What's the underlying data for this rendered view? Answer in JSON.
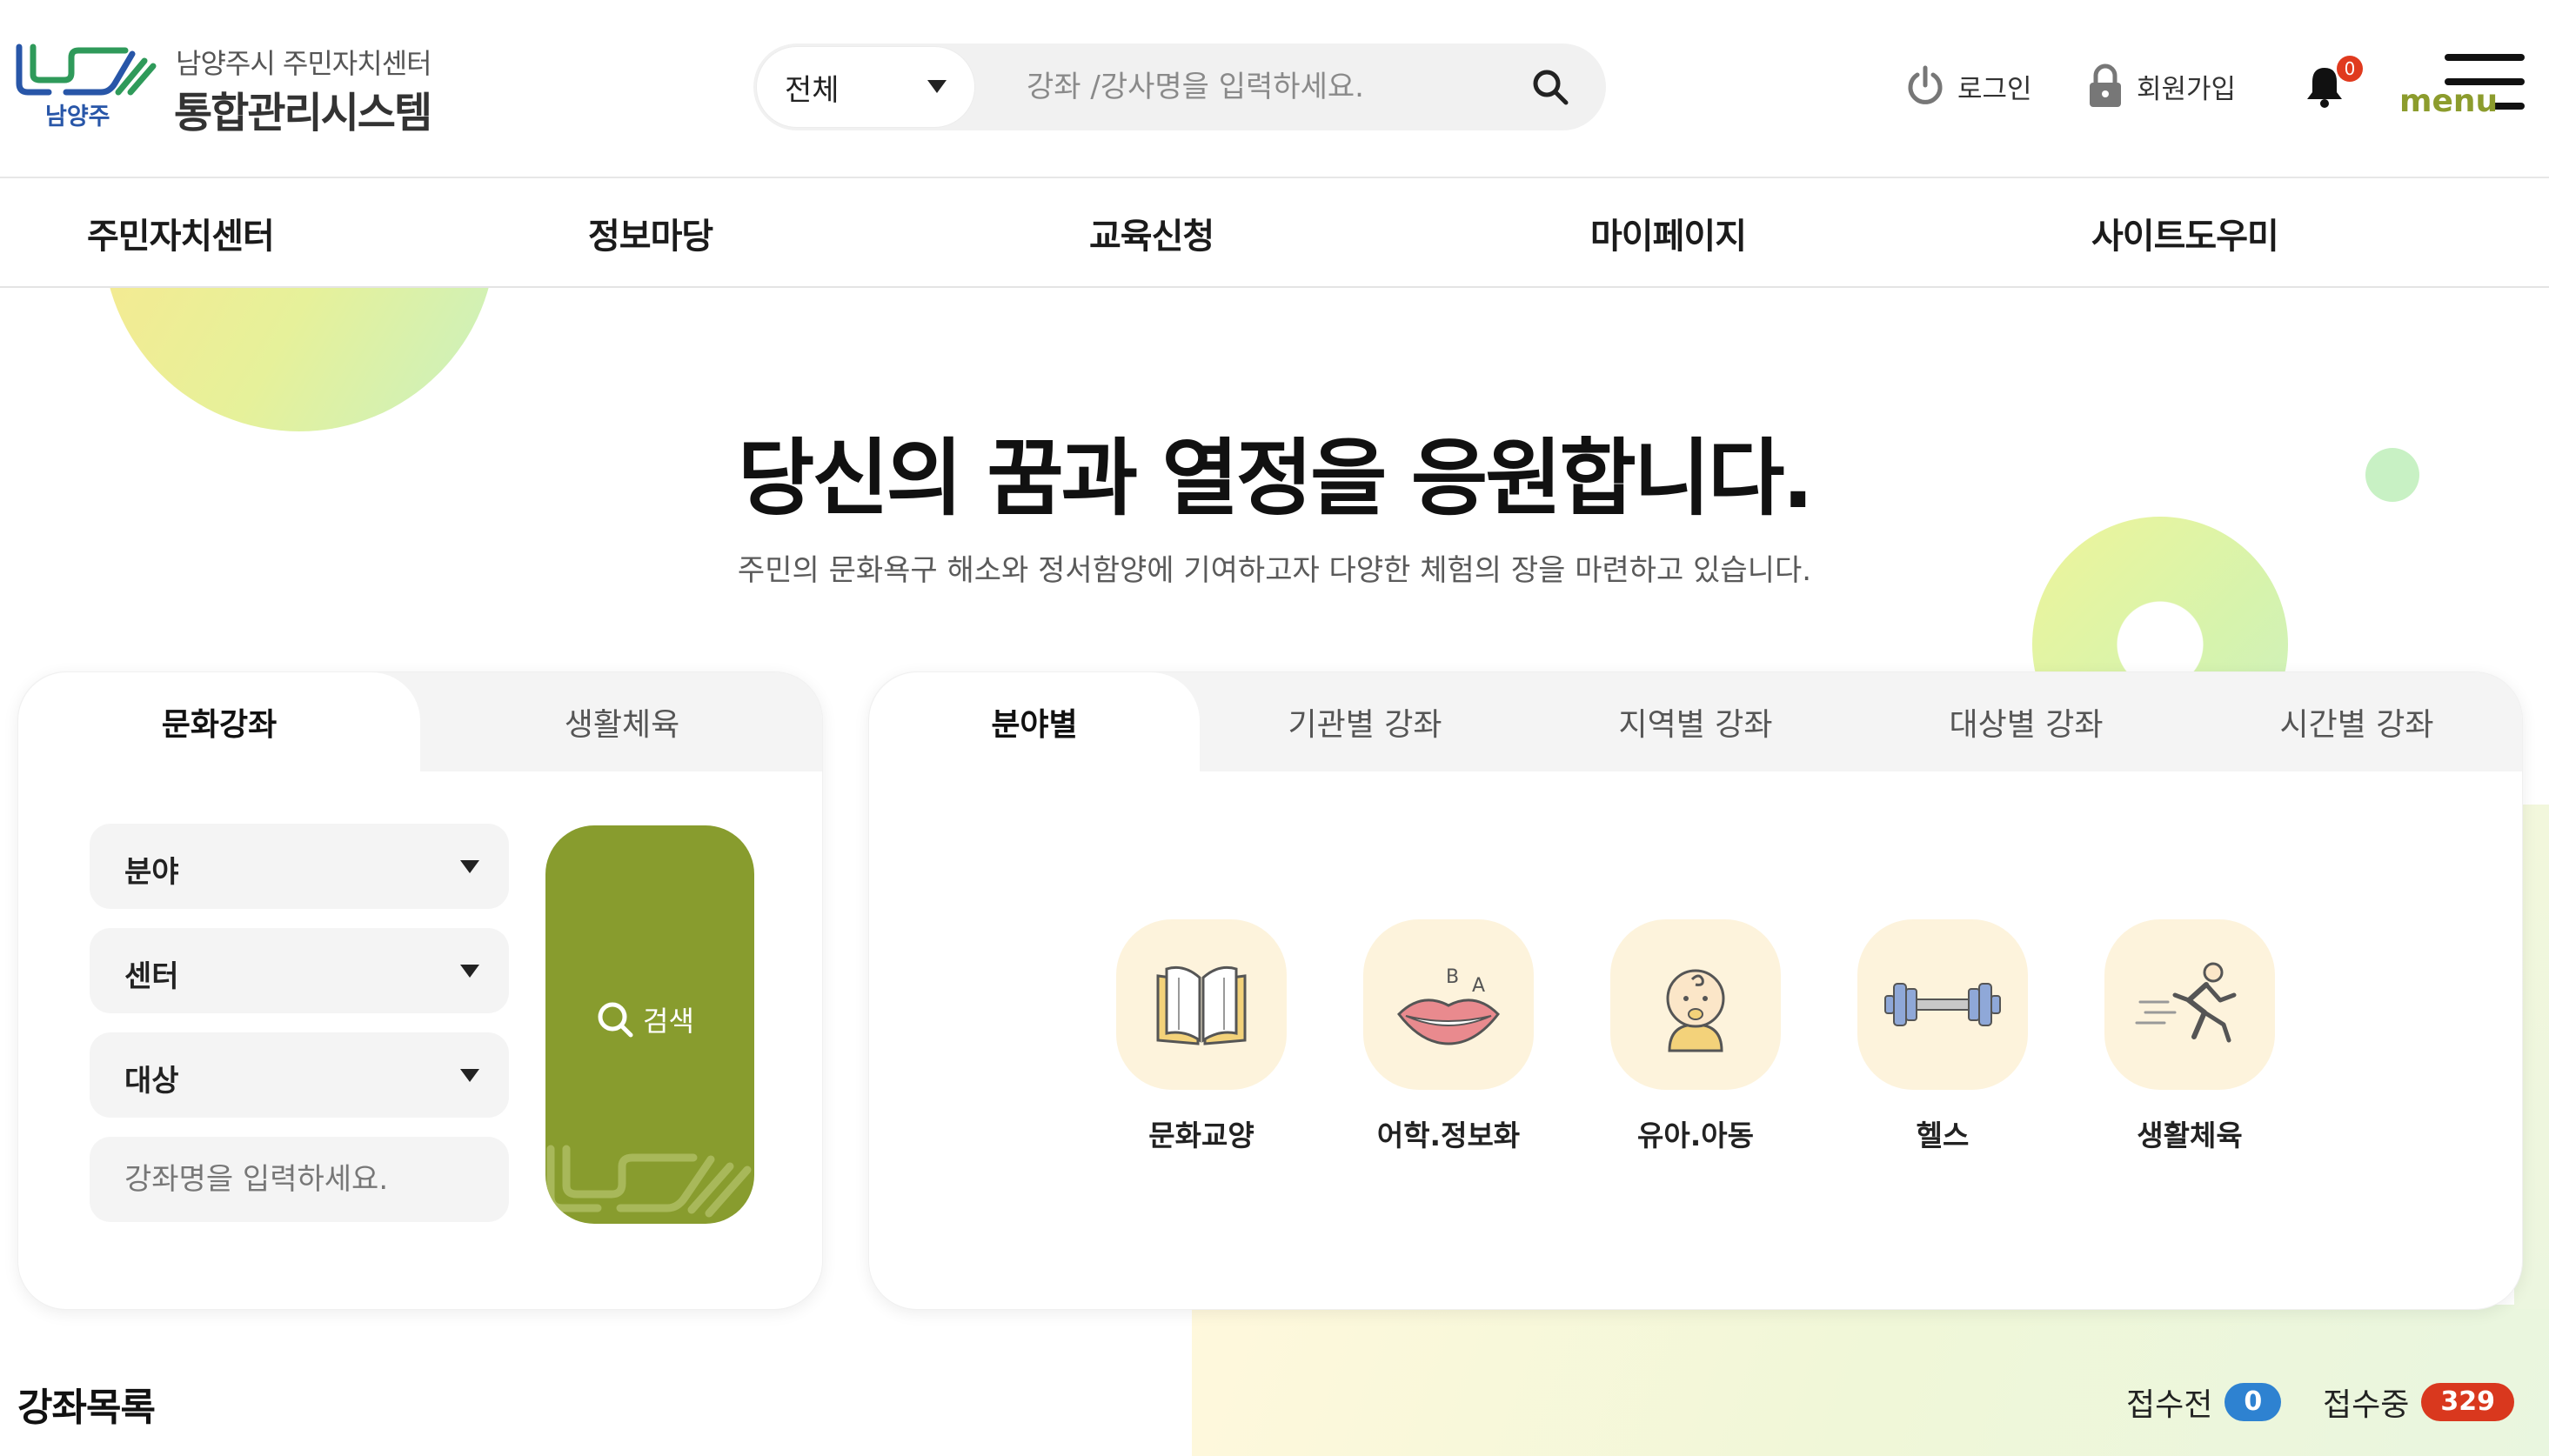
{
  "header": {
    "logo_city": "남양주",
    "logo_subtitle": "남양주시 주민자치센터",
    "logo_title": "통합관리시스템",
    "search": {
      "scope_selected": "전체",
      "placeholder": "강좌 /강사명을 입력하세요."
    },
    "login_label": "로그인",
    "join_label": "회원가입",
    "notification_count": "0",
    "menu_label": "menu"
  },
  "nav": {
    "items": [
      {
        "label": "주민자치센터"
      },
      {
        "label": "정보마당"
      },
      {
        "label": "교육신청"
      },
      {
        "label": "마이페이지"
      },
      {
        "label": "사이트도우미"
      }
    ]
  },
  "hero": {
    "title": "당신의 꿈과 열정을 응원합니다.",
    "subtitle": "주민의 문화욕구 해소와 정서함양에 기여하고자 다양한 체험의 장을 마련하고 있습니다."
  },
  "search_panel": {
    "tabs": [
      {
        "label": "문화강좌",
        "active": true
      },
      {
        "label": "생활체육",
        "active": false
      }
    ],
    "filters": [
      {
        "label": "분야"
      },
      {
        "label": "센터"
      },
      {
        "label": "대상"
      }
    ],
    "keyword_placeholder": "강좌명을 입력하세요.",
    "search_button_label": "검색"
  },
  "category_panel": {
    "tabs": [
      {
        "label": "분야별",
        "active": true
      },
      {
        "label": "기관별 강좌",
        "active": false
      },
      {
        "label": "지역별 강좌",
        "active": false
      },
      {
        "label": "대상별 강좌",
        "active": false
      },
      {
        "label": "시간별 강좌",
        "active": false
      }
    ],
    "categories": [
      {
        "label": "문화교양",
        "icon": "book-icon"
      },
      {
        "label": "어학.정보화",
        "icon": "lips-language-icon"
      },
      {
        "label": "유아.아동",
        "icon": "baby-icon"
      },
      {
        "label": "헬스",
        "icon": "dumbbell-icon"
      },
      {
        "label": "생활체육",
        "icon": "runner-icon"
      }
    ]
  },
  "course_list": {
    "title": "강좌목록",
    "before_label": "접수전",
    "before_count": "0",
    "open_label": "접수중",
    "open_count": "329"
  },
  "colors": {
    "brand_green": "#889c2e",
    "menu_green": "#8c9c2d",
    "badge_blue": "#2e82d1",
    "badge_red": "#d9381e",
    "notification_red": "#e03a1e",
    "icon_bg": "#fdf3dc"
  }
}
